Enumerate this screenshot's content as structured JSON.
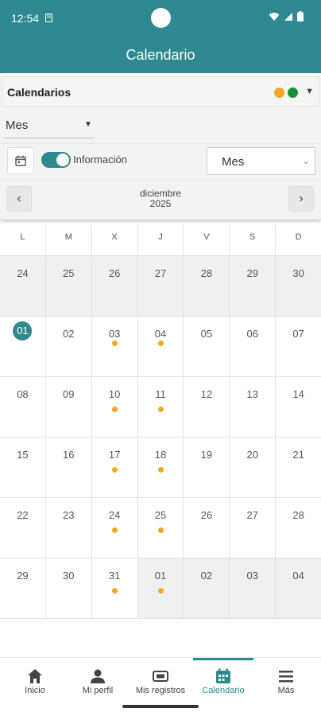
{
  "status": {
    "time": "12:54",
    "sim": "N"
  },
  "app": {
    "title": "Calendario"
  },
  "filters": {
    "calendars_label": "Calendarios",
    "calendar_colors": [
      "#f5a623",
      "#1a8f3c"
    ],
    "view_select": "Mes",
    "info_label": "Información",
    "info_toggle_on": true,
    "mode_select": "Mes"
  },
  "nav": {
    "prev": "‹",
    "next": "›",
    "month": "diciembre",
    "year": "2025"
  },
  "weekdays": [
    "L",
    "M",
    "X",
    "J",
    "V",
    "S",
    "D"
  ],
  "event_color": "#f5a623",
  "accent": "#2e8a90",
  "weeks": [
    [
      {
        "d": "24",
        "grey": true
      },
      {
        "d": "25",
        "grey": true
      },
      {
        "d": "26",
        "grey": true
      },
      {
        "d": "27",
        "grey": true
      },
      {
        "d": "28",
        "grey": true
      },
      {
        "d": "29",
        "grey": true
      },
      {
        "d": "30",
        "grey": true
      }
    ],
    [
      {
        "d": "01",
        "today": true
      },
      {
        "d": "02"
      },
      {
        "d": "03",
        "event": true
      },
      {
        "d": "04",
        "event": true
      },
      {
        "d": "05"
      },
      {
        "d": "06"
      },
      {
        "d": "07"
      }
    ],
    [
      {
        "d": "08"
      },
      {
        "d": "09"
      },
      {
        "d": "10",
        "event": true
      },
      {
        "d": "11",
        "event": true
      },
      {
        "d": "12"
      },
      {
        "d": "13"
      },
      {
        "d": "14"
      }
    ],
    [
      {
        "d": "15"
      },
      {
        "d": "16"
      },
      {
        "d": "17",
        "event": true
      },
      {
        "d": "18",
        "event": true
      },
      {
        "d": "19"
      },
      {
        "d": "20"
      },
      {
        "d": "21"
      }
    ],
    [
      {
        "d": "22"
      },
      {
        "d": "23"
      },
      {
        "d": "24",
        "event": true
      },
      {
        "d": "25",
        "event": true
      },
      {
        "d": "26"
      },
      {
        "d": "27"
      },
      {
        "d": "28"
      }
    ],
    [
      {
        "d": "29"
      },
      {
        "d": "30"
      },
      {
        "d": "31",
        "event": true
      },
      {
        "d": "01",
        "event": true,
        "grey": true
      },
      {
        "d": "02",
        "grey": true
      },
      {
        "d": "03",
        "grey": true
      },
      {
        "d": "04",
        "grey": true
      }
    ]
  ],
  "bottom_nav": [
    {
      "label": "Inicio",
      "icon": "home-icon"
    },
    {
      "label": "Mi perfil",
      "icon": "person-icon"
    },
    {
      "label": "Mis registros",
      "icon": "ticket-icon"
    },
    {
      "label": "Calendario",
      "icon": "calendar-icon",
      "active": true
    },
    {
      "label": "Más",
      "icon": "menu-icon"
    }
  ]
}
